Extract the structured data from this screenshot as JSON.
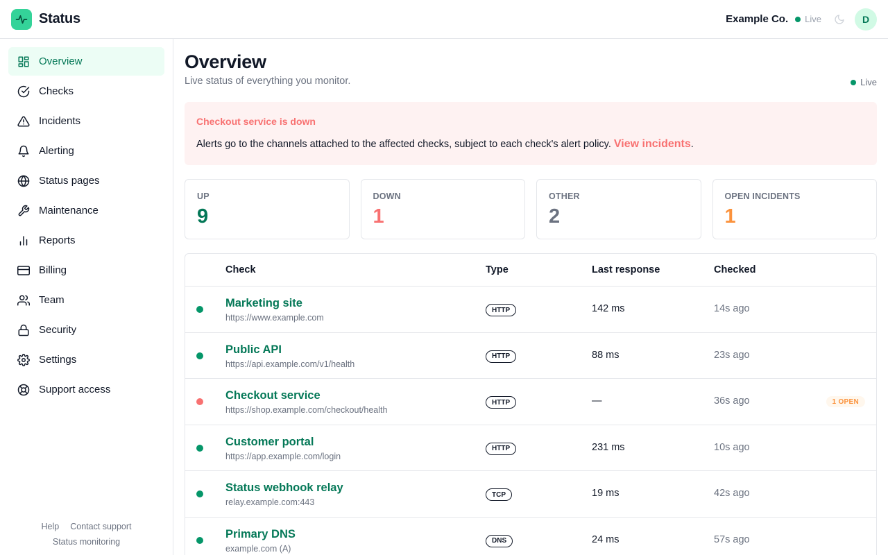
{
  "app": {
    "name": "Status",
    "org": "Example Co.",
    "live_label": "Live",
    "avatar_initial": "D"
  },
  "sidebar": {
    "items": [
      {
        "label": "Overview",
        "icon": "grid-icon"
      },
      {
        "label": "Checks",
        "icon": "check-circle-icon"
      },
      {
        "label": "Incidents",
        "icon": "warning-icon"
      },
      {
        "label": "Alerting",
        "icon": "bell-icon"
      },
      {
        "label": "Status pages",
        "icon": "globe-icon"
      },
      {
        "label": "Maintenance",
        "icon": "wrench-icon"
      },
      {
        "label": "Reports",
        "icon": "bar-chart-icon"
      },
      {
        "label": "Billing",
        "icon": "credit-card-icon"
      },
      {
        "label": "Team",
        "icon": "users-icon"
      },
      {
        "label": "Security",
        "icon": "lock-icon"
      },
      {
        "label": "Settings",
        "icon": "gear-icon"
      },
      {
        "label": "Support access",
        "icon": "lifebuoy-icon"
      }
    ],
    "footer": {
      "help": "Help",
      "contact": "Contact support",
      "tagline": "Status monitoring"
    }
  },
  "main": {
    "title": "Overview",
    "subtitle": "Live status of everything you monitor.",
    "live_label": "Live",
    "alert": {
      "title": "Checkout service is down",
      "body": "Alerts go to the channels attached to the affected checks, subject to each check's alert policy.",
      "link": "View incidents",
      "suffix": "."
    },
    "stats": [
      {
        "label": "UP",
        "value": "9",
        "color": "#047857"
      },
      {
        "label": "DOWN",
        "value": "1",
        "color": "#f87171"
      },
      {
        "label": "OTHER",
        "value": "2",
        "color": "#6b7280"
      },
      {
        "label": "OPEN INCIDENTS",
        "value": "1",
        "color": "#fb923c"
      }
    ],
    "table": {
      "headers": [
        "Check",
        "Type",
        "Last response",
        "Checked"
      ],
      "rows": [
        {
          "name": "Marketing site",
          "url": "https://www.example.com",
          "type": "HTTP",
          "response": "142 ms",
          "checked": "14s ago",
          "status": "up"
        },
        {
          "name": "Public API",
          "url": "https://api.example.com/v1/health",
          "type": "HTTP",
          "response": "88 ms",
          "checked": "23s ago",
          "status": "up"
        },
        {
          "name": "Checkout service",
          "url": "https://shop.example.com/checkout/health",
          "type": "HTTP",
          "response": "—",
          "checked": "36s ago",
          "status": "down",
          "badge": "1 OPEN"
        },
        {
          "name": "Customer portal",
          "url": "https://app.example.com/login",
          "type": "HTTP",
          "response": "231 ms",
          "checked": "10s ago",
          "status": "up"
        },
        {
          "name": "Status webhook relay",
          "url": "relay.example.com:443",
          "type": "TCP",
          "response": "19 ms",
          "checked": "42s ago",
          "status": "up"
        },
        {
          "name": "Primary DNS",
          "url": "example.com (A)",
          "type": "DNS",
          "response": "24 ms",
          "checked": "57s ago",
          "status": "up"
        }
      ]
    }
  },
  "colors": {
    "accent": "#047857",
    "up": "#059669",
    "down": "#f87171",
    "warning": "#fb923c"
  }
}
